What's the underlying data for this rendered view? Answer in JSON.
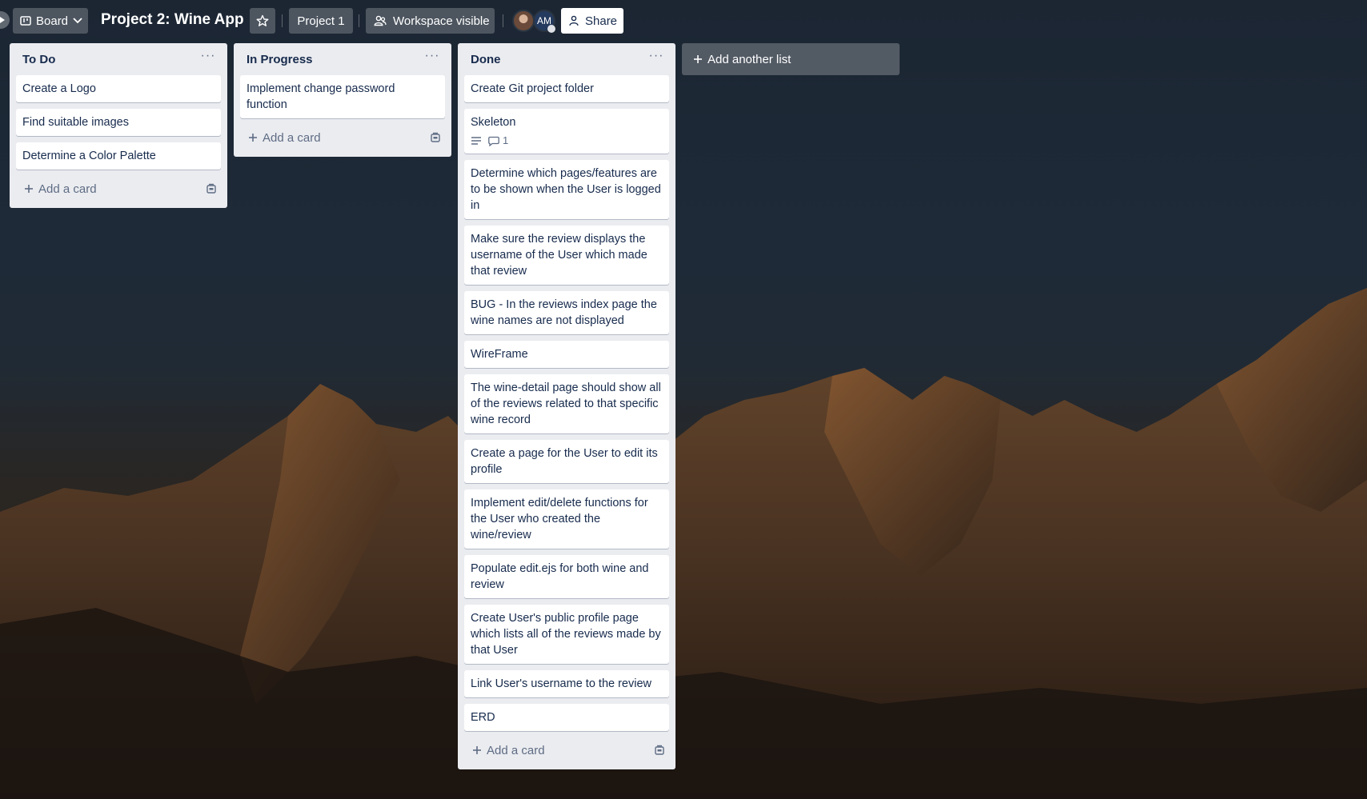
{
  "header": {
    "view_switch_label": "Board",
    "board_title": "Project 2: Wine App",
    "team_label": "Project 1",
    "visibility_label": "Workspace visible",
    "member_initials": "AM",
    "share_label": "Share"
  },
  "lists": [
    {
      "title": "To Do",
      "cards": [
        {
          "title": "Create a Logo"
        },
        {
          "title": "Find suitable images"
        },
        {
          "title": "Determine a Color Palette"
        }
      ],
      "add_card_label": "Add a card"
    },
    {
      "title": "In Progress",
      "cards": [
        {
          "title": "Implement change password function"
        }
      ],
      "add_card_label": "Add a card"
    },
    {
      "title": "Done",
      "cards": [
        {
          "title": "Create Git project folder"
        },
        {
          "title": "Skeleton",
          "comment_count": "1"
        },
        {
          "title": "Determine which pages/features are to be shown when the User is logged in"
        },
        {
          "title": "Make sure the review displays the username of the User which made that review"
        },
        {
          "title": "BUG - In the reviews index page the wine names are not displayed"
        },
        {
          "title": "WireFrame"
        },
        {
          "title": "The wine-detail page should show all of the reviews related to that specific wine record"
        },
        {
          "title": "Create a page for the User to edit its profile"
        },
        {
          "title": "Implement edit/delete functions for the User who created the wine/review"
        },
        {
          "title": "Populate edit.ejs for both wine and review"
        },
        {
          "title": "Create User's public profile page which lists all of the reviews made by that User"
        },
        {
          "title": "Link User's username to the review"
        },
        {
          "title": "ERD"
        }
      ],
      "add_card_label": "Add a card"
    }
  ],
  "add_list_label": "Add another list"
}
